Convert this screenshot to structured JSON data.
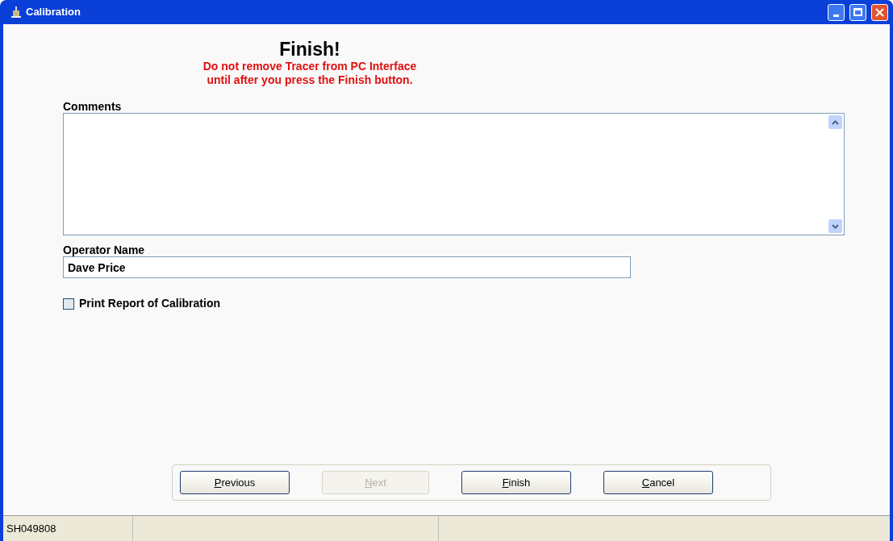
{
  "window": {
    "title": "Calibration"
  },
  "heading": "Finish!",
  "warning": [
    "Do not remove Tracer from PC Interface",
    "until after you press the Finish button."
  ],
  "comments": {
    "label": "Comments"
  },
  "operator": {
    "label": "Operator Name",
    "value": "Dave Price"
  },
  "print_report": {
    "label": "Print Report of Calibration",
    "checked": false
  },
  "buttons": [
    {
      "label": "Previous",
      "disabled": false
    },
    {
      "label": "Next",
      "disabled": true
    },
    {
      "label": "Finish",
      "disabled": false
    },
    {
      "label": "Cancel",
      "disabled": false
    }
  ],
  "status_bar": [
    "SH049808"
  ]
}
